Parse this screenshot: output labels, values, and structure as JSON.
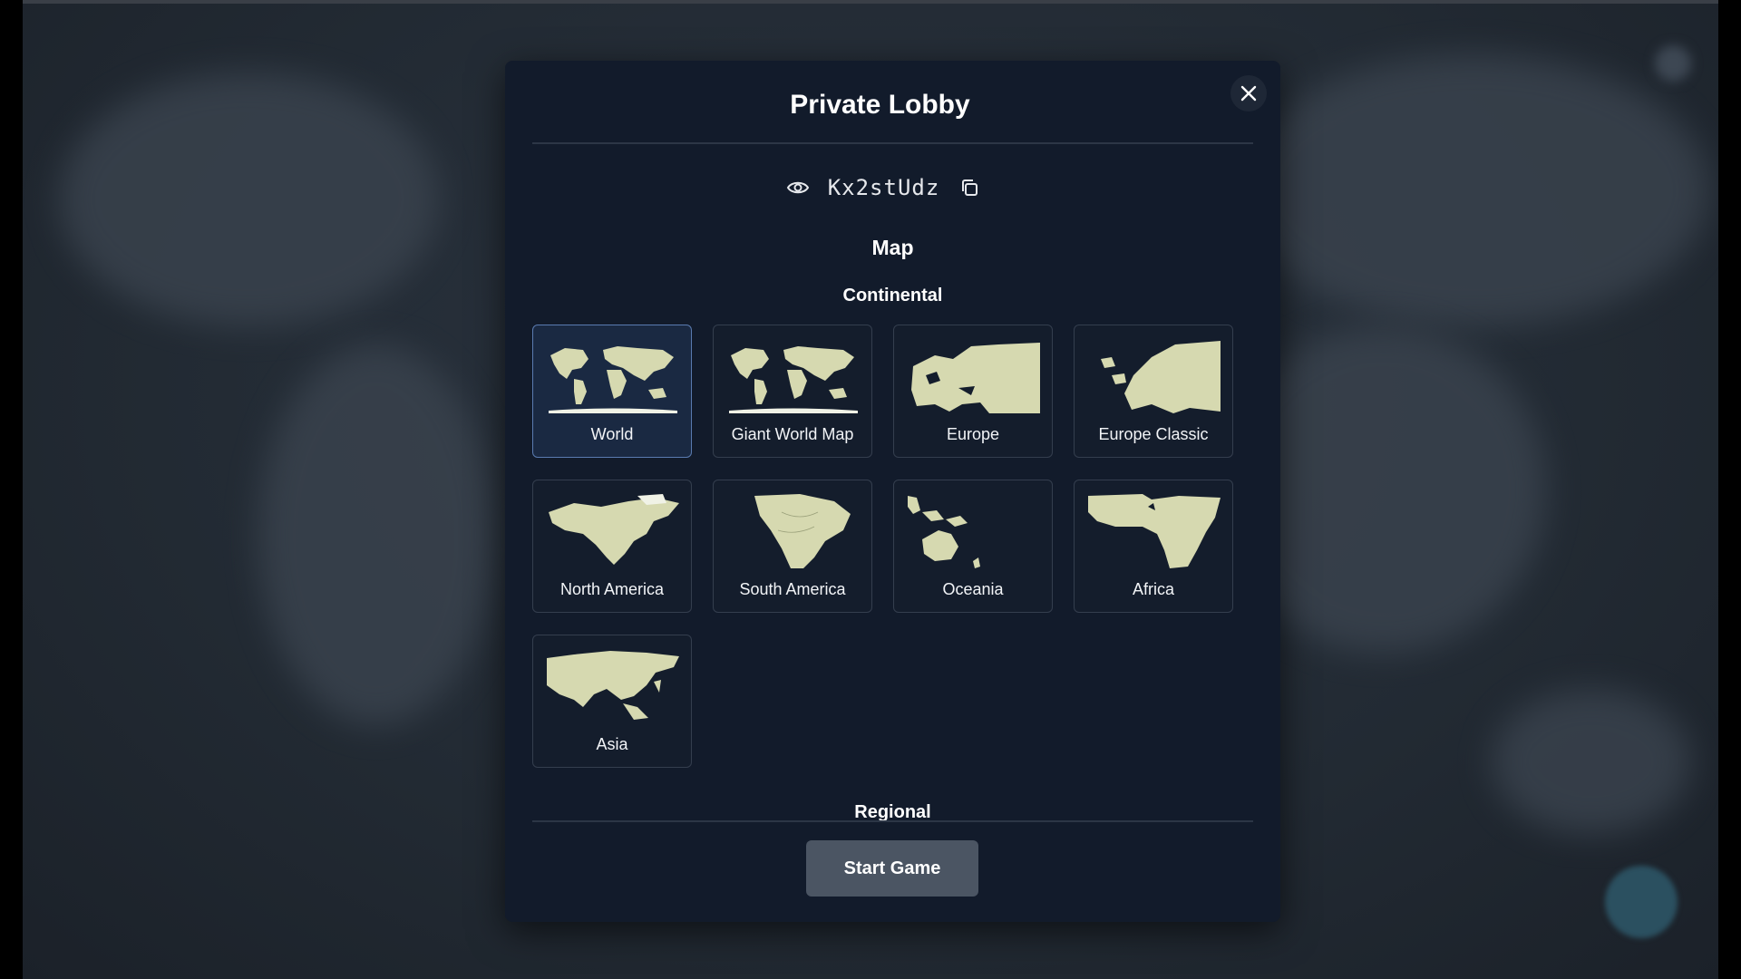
{
  "modal": {
    "title": "Private Lobby",
    "lobby_code": "Kx2stUdz",
    "icons": {
      "visibility": "eye-icon",
      "copy": "copy-icon",
      "close": "close-icon"
    }
  },
  "map_section": {
    "title": "Map",
    "continental_title": "Continental",
    "regional_title": "Regional",
    "maps": [
      {
        "label": "World",
        "selected": true
      },
      {
        "label": "Giant World Map",
        "selected": false
      },
      {
        "label": "Europe",
        "selected": false
      },
      {
        "label": "Europe Classic",
        "selected": false
      },
      {
        "label": "North America",
        "selected": false
      },
      {
        "label": "South America",
        "selected": false
      },
      {
        "label": "Oceania",
        "selected": false
      },
      {
        "label": "Africa",
        "selected": false
      },
      {
        "label": "Asia",
        "selected": false
      }
    ]
  },
  "actions": {
    "start_label": "Start Game"
  },
  "colors": {
    "modal_bg": "#121b2b",
    "selected_border": "#5a7bb0",
    "land": "#d6d9b0",
    "start_button": "#4b5563"
  }
}
